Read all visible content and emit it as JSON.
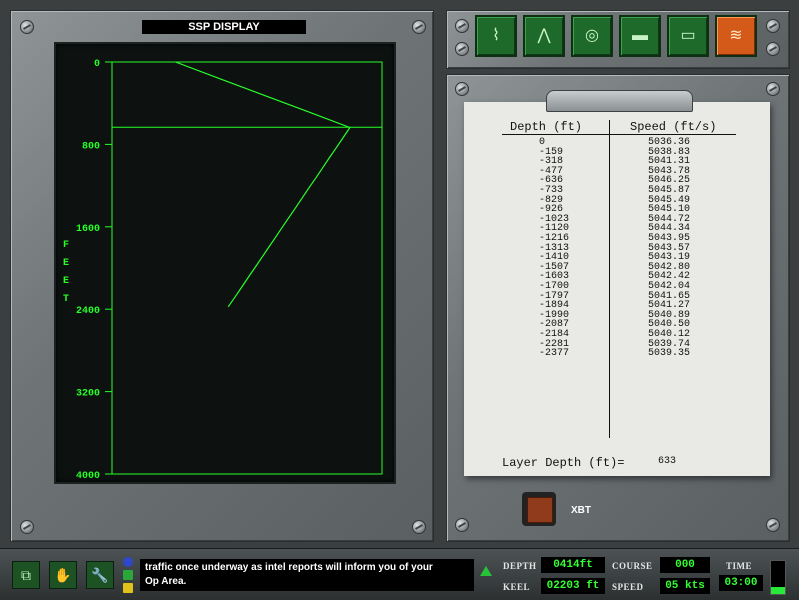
{
  "ssp_display": {
    "title": "SSP DISPLAY",
    "axis_label": "FEET",
    "axis_label_letters": [
      "F",
      "E",
      "E",
      "T"
    ],
    "tick_labels": [
      "0",
      "800",
      "1600",
      "2400",
      "3200",
      "4000"
    ]
  },
  "chart_data": {
    "type": "line",
    "title": "SSP DISPLAY",
    "ylabel": "FEET",
    "ylim": [
      0,
      4000
    ],
    "y_ticks": [
      0,
      800,
      1600,
      2400,
      3200,
      4000
    ],
    "layer_depth": 633,
    "color": "#27ff27",
    "series": [
      {
        "values": [
          {
            "depth": 0,
            "speed": 5036.36
          },
          {
            "depth": 159,
            "speed": 5038.83
          },
          {
            "depth": 318,
            "speed": 5041.31
          },
          {
            "depth": 477,
            "speed": 5043.78
          },
          {
            "depth": 636,
            "speed": 5046.25
          },
          {
            "depth": 733,
            "speed": 5045.87
          },
          {
            "depth": 829,
            "speed": 5045.49
          },
          {
            "depth": 926,
            "speed": 5045.1
          },
          {
            "depth": 1023,
            "speed": 5044.72
          },
          {
            "depth": 1120,
            "speed": 5044.34
          },
          {
            "depth": 1216,
            "speed": 5043.95
          },
          {
            "depth": 1313,
            "speed": 5043.57
          },
          {
            "depth": 1410,
            "speed": 5043.19
          },
          {
            "depth": 1507,
            "speed": 5042.8
          },
          {
            "depth": 1603,
            "speed": 5042.42
          },
          {
            "depth": 1700,
            "speed": 5042.04
          },
          {
            "depth": 1797,
            "speed": 5041.65
          },
          {
            "depth": 1894,
            "speed": 5041.27
          },
          {
            "depth": 1990,
            "speed": 5040.89
          },
          {
            "depth": 2087,
            "speed": 5040.5
          },
          {
            "depth": 2184,
            "speed": 5040.12
          },
          {
            "depth": 2281,
            "speed": 5039.74
          },
          {
            "depth": 2377,
            "speed": 5039.35
          }
        ]
      }
    ]
  },
  "mode_buttons": [
    {
      "icon": "sonar-waveform-icon",
      "glyph": "⌇"
    },
    {
      "icon": "spectrum-icon",
      "glyph": "⋀"
    },
    {
      "icon": "active-sonar-icon",
      "glyph": "◎"
    },
    {
      "icon": "submarine-icon",
      "glyph": "▬"
    },
    {
      "icon": "towed-array-icon",
      "glyph": "▭"
    },
    {
      "icon": "ssp-profile-icon",
      "glyph": "≋"
    }
  ],
  "table": {
    "depth_header": "Depth (ft)",
    "speed_header": "Speed (ft/s)",
    "rows": [
      {
        "depth": "0",
        "speed": "5036.36"
      },
      {
        "depth": "-159",
        "speed": "5038.83"
      },
      {
        "depth": "-318",
        "speed": "5041.31"
      },
      {
        "depth": "-477",
        "speed": "5043.78"
      },
      {
        "depth": "-636",
        "speed": "5046.25"
      },
      {
        "depth": "-733",
        "speed": "5045.87"
      },
      {
        "depth": "-829",
        "speed": "5045.49"
      },
      {
        "depth": "-926",
        "speed": "5045.10"
      },
      {
        "depth": "-1023",
        "speed": "5044.72"
      },
      {
        "depth": "-1120",
        "speed": "5044.34"
      },
      {
        "depth": "-1216",
        "speed": "5043.95"
      },
      {
        "depth": "-1313",
        "speed": "5043.57"
      },
      {
        "depth": "-1410",
        "speed": "5043.19"
      },
      {
        "depth": "-1507",
        "speed": "5042.80"
      },
      {
        "depth": "-1603",
        "speed": "5042.42"
      },
      {
        "depth": "-1700",
        "speed": "5042.04"
      },
      {
        "depth": "-1797",
        "speed": "5041.65"
      },
      {
        "depth": "-1894",
        "speed": "5041.27"
      },
      {
        "depth": "-1990",
        "speed": "5040.89"
      },
      {
        "depth": "-2087",
        "speed": "5040.50"
      },
      {
        "depth": "-2184",
        "speed": "5040.12"
      },
      {
        "depth": "-2281",
        "speed": "5039.74"
      },
      {
        "depth": "-2377",
        "speed": "5039.35"
      }
    ],
    "layer_depth_label": "Layer Depth (ft)=",
    "layer_depth_value": "633"
  },
  "xbt": {
    "label": "XBT"
  },
  "bottom_bar": {
    "tools": [
      {
        "icon": "window-toggle-icon",
        "glyph": "⧉"
      },
      {
        "icon": "hand-icon",
        "glyph": "✋"
      },
      {
        "icon": "wrench-icon",
        "glyph": "🔧"
      }
    ],
    "message_line1": "traffic once underway as intel reports will inform you of your",
    "message_line2": "Op Area.",
    "depth_label": "DEPTH",
    "depth_value": "0414ft",
    "keel_label": "KEEL",
    "keel_value": "02203 ft",
    "course_label": "COURSE",
    "course_value": "000",
    "speed_label": "SPEED",
    "speed_value": "05 kts",
    "time_label": "TIME",
    "time_value": "03:00",
    "time_fill": 0.2
  },
  "colors": {
    "phosphor_green": "#27ff27",
    "button_green": "#1d6a2b",
    "button_active": "#d45a19"
  }
}
